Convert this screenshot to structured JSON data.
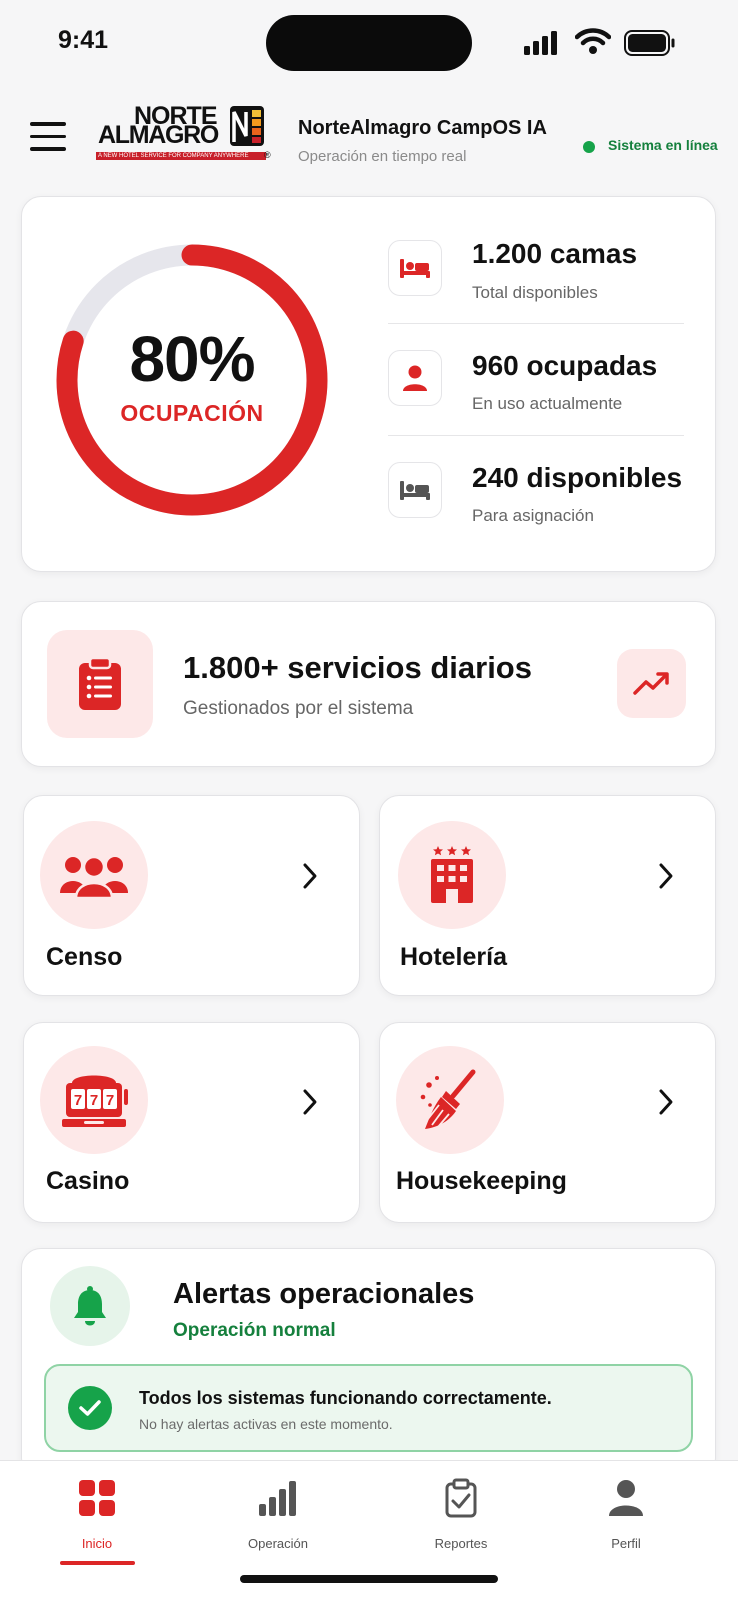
{
  "status_bar": {
    "time": "9:41"
  },
  "header": {
    "logo": {
      "line1": "NORTE",
      "line2": "ALMAGRO",
      "tagline": "A NEW HOTEL SERVICE FOR COMPANY ANYWHERE",
      "registered": "®"
    },
    "title": "NorteAlmagro CampOS IA",
    "subtitle": "Operación en tiempo real",
    "status_text": "Sistema en línea",
    "status_color": "#16a34a"
  },
  "occupancy": {
    "percent_label": "80%",
    "label": "OCUPACIÓN",
    "fraction": 0.8,
    "stats": [
      {
        "icon": "bed-icon",
        "value": "1.200 camas",
        "caption": "Total disponibles"
      },
      {
        "icon": "person-icon",
        "value": "960 ocupadas",
        "caption": "En uso actualmente"
      },
      {
        "icon": "bed-icon",
        "value": "240 disponibles",
        "caption": "Para asignación"
      }
    ]
  },
  "services": {
    "title": "1.800+ servicios diarios",
    "subtitle": "Gestionados por el sistema",
    "icon": "clipboard-list-icon",
    "action_icon": "trend-up-icon"
  },
  "modules": [
    {
      "label": "Censo",
      "icon": "group-icon"
    },
    {
      "label": "Hotelería",
      "icon": "hotel-icon"
    },
    {
      "label": "Casino",
      "icon": "slot-machine-icon"
    },
    {
      "label": "Housekeeping",
      "icon": "broom-icon"
    }
  ],
  "alerts": {
    "title": "Alertas operacionales",
    "status": "Operación normal",
    "message_title": "Todos los sistemas funcionando correctamente.",
    "message_sub": "No hay alertas activas en este momento."
  },
  "tabs": [
    {
      "label": "Inicio",
      "icon": "grid-icon",
      "active": true
    },
    {
      "label": "Operación",
      "icon": "bars-icon",
      "active": false
    },
    {
      "label": "Reportes",
      "icon": "clipboard-check-icon",
      "active": false
    },
    {
      "label": "Perfil",
      "icon": "user-icon",
      "active": false
    }
  ],
  "colors": {
    "accent": "#dc2626",
    "accent_soft": "#fde8e8",
    "success": "#16a34a"
  }
}
